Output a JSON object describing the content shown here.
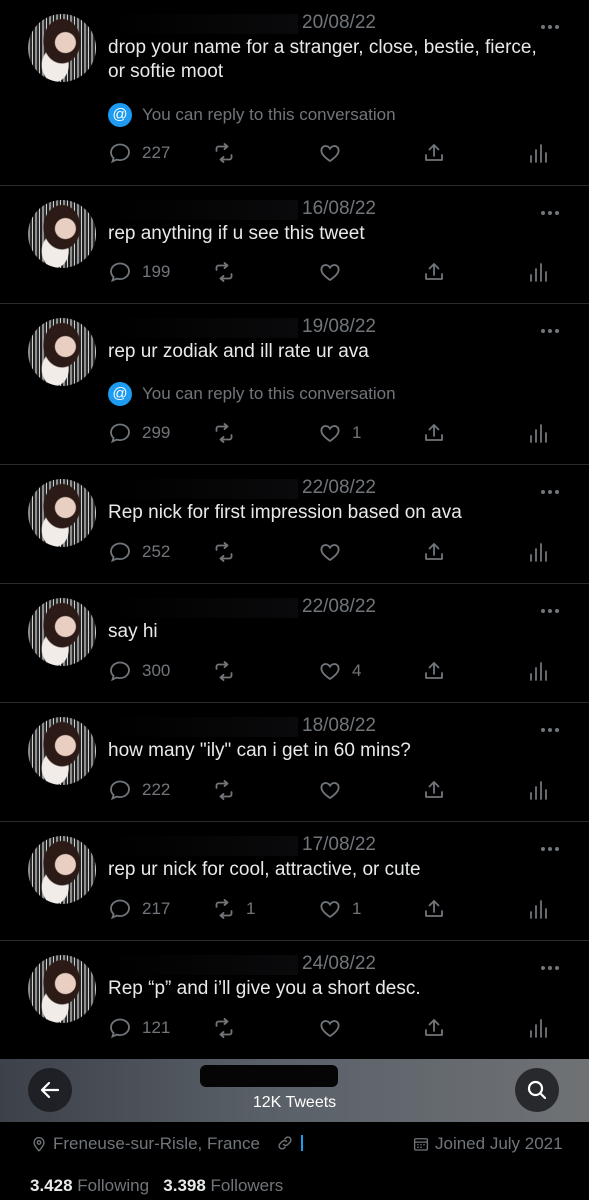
{
  "colors": {
    "background": "#000000",
    "muted": "#71767b",
    "accent": "#1d9bf0",
    "text": "#e7e9ea"
  },
  "tweets": [
    {
      "date": "20/08/22",
      "text": "drop your name for a stranger, close, bestie, fierce, or softie moot",
      "reply_note": "You can reply to this conversation",
      "replies": "227",
      "retweets": "",
      "likes": ""
    },
    {
      "date": "16/08/22",
      "text": "rep anything if u see this tweet",
      "reply_note": "",
      "replies": "199",
      "retweets": "",
      "likes": ""
    },
    {
      "date": "19/08/22",
      "text": "rep ur zodiak and ill rate ur ava",
      "reply_note": "You can reply to this conversation",
      "replies": "299",
      "retweets": "",
      "likes": "1"
    },
    {
      "date": "22/08/22",
      "text": "Rep nick for first impression based on ava",
      "reply_note": "",
      "replies": "252",
      "retweets": "",
      "likes": ""
    },
    {
      "date": "22/08/22",
      "text": "say hi",
      "reply_note": "",
      "replies": "300",
      "retweets": "",
      "likes": "4"
    },
    {
      "date": "18/08/22",
      "text": "how many \"ily\" can i get in 60 mins?",
      "reply_note": "",
      "replies": "222",
      "retweets": "",
      "likes": ""
    },
    {
      "date": "17/08/22",
      "text": "rep ur nick for cool, attractive, or cute",
      "reply_note": "",
      "replies": "217",
      "retweets": "1",
      "likes": "1"
    },
    {
      "date": "24/08/22",
      "text": "Rep “p” and i’ll give you a short desc.",
      "reply_note": "",
      "replies": "121",
      "retweets": "",
      "likes": ""
    }
  ],
  "profile_bar": {
    "tweet_count": "12K Tweets"
  },
  "profile": {
    "location": "Freneuse-sur-Risle, France",
    "joined": "Joined July 2021",
    "following_count": "3.428",
    "following_label": "Following",
    "followers_count": "3.398",
    "followers_label": "Followers"
  },
  "icons": {
    "reply": "reply-icon",
    "retweet": "retweet-icon",
    "like": "heart-icon",
    "share": "share-icon",
    "stats": "stats-icon",
    "more": "more-icon",
    "back": "arrow-left-icon",
    "search": "search-icon",
    "location": "location-pin-icon",
    "link": "link-icon",
    "calendar": "calendar-icon"
  }
}
